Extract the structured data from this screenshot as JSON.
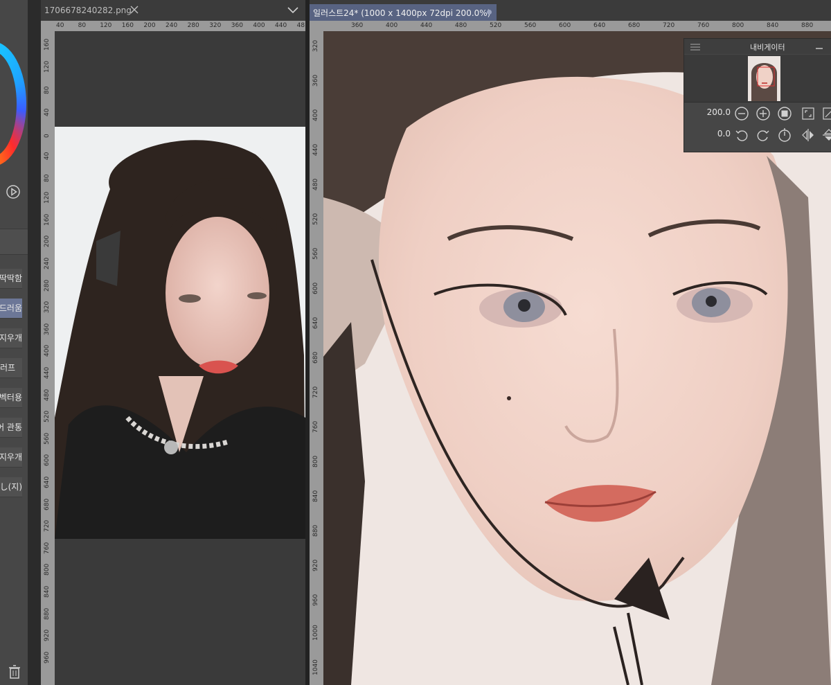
{
  "left_panel": {
    "brush_items": [
      {
        "label": "딱딱함",
        "selected": false
      },
      {
        "label": "부드러움",
        "selected": true
      },
      {
        "label": "지우개",
        "selected": false
      },
      {
        "label": "러프",
        "selected": false
      },
      {
        "label": "벡터용",
        "selected": false
      },
      {
        "label": "레이어 관통",
        "selected": false
      },
      {
        "label": "지우개",
        "selected": false
      },
      {
        "label": "(지)消し",
        "selected": false
      }
    ]
  },
  "sub_window_1": {
    "tab_label": "1706678240282.png",
    "ruler_h_labels": [
      "40",
      "80",
      "120",
      "160",
      "200",
      "240",
      "280",
      "320",
      "360",
      "400",
      "440",
      "48"
    ],
    "ruler_v_labels": [
      "160",
      "120",
      "80",
      "40",
      "0",
      "40",
      "80",
      "120",
      "160",
      "200",
      "240",
      "280",
      "320",
      "360",
      "400",
      "440",
      "480",
      "520",
      "560",
      "600",
      "640",
      "680",
      "720",
      "760",
      "800",
      "840",
      "880",
      "920",
      "960"
    ]
  },
  "sub_window_2": {
    "tab_label": "일러스트24* (1000 x 1400px 72dpi 200.0%)",
    "ruler_h_labels": [
      "360",
      "400",
      "440",
      "480",
      "520",
      "560",
      "600",
      "640",
      "680",
      "720",
      "760",
      "800",
      "840",
      "880"
    ],
    "ruler_v_labels": [
      "320",
      "360",
      "400",
      "440",
      "480",
      "520",
      "560",
      "600",
      "640",
      "680",
      "720",
      "760",
      "800",
      "840",
      "880",
      "920",
      "960",
      "1000",
      "1040"
    ]
  },
  "navigator": {
    "title": "내비게이터",
    "zoom_value": "200.0",
    "rotation_value": "0.0"
  },
  "colors": {
    "panel_bg": "#474747",
    "selected_item": "#6c7797",
    "active_tab": "#586382",
    "ruler": "#9a9a9a",
    "canvas_dark": "#3a3a3a"
  }
}
